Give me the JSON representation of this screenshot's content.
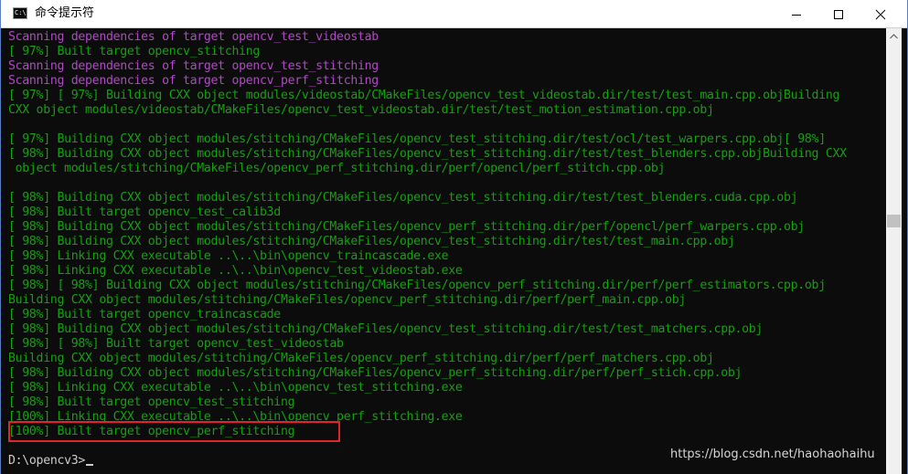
{
  "window": {
    "title": "命令提示符",
    "icon": "cmd-icon",
    "controls": [
      "minimize-icon",
      "maximize-icon",
      "close-icon"
    ]
  },
  "colors": {
    "background": "#0c0c0c",
    "magenta_text": "#b148c6",
    "green_text": "#13a10e",
    "default_text": "#cccccc",
    "highlight_box": "#e0242a"
  },
  "console": {
    "lines": [
      {
        "text": "Scanning dependencies of target opencv_test_videostab",
        "color": "magenta"
      },
      {
        "text": "[ 97%] Built target opencv_stitching",
        "color": "green"
      },
      {
        "text": "Scanning dependencies of target opencv_test_stitching",
        "color": "magenta"
      },
      {
        "text": "Scanning dependencies of target opencv_perf_stitching",
        "color": "magenta"
      },
      {
        "text": "[ 97%] [ 97%] Building CXX object modules/videostab/CMakeFiles/opencv_test_videostab.dir/test/test_main.cpp.objBuilding",
        "color": "green"
      },
      {
        "text": "CXX object modules/videostab/CMakeFiles/opencv_test_videostab.dir/test/test_motion_estimation.cpp.obj",
        "color": "green"
      },
      {
        "text": "",
        "color": "green"
      },
      {
        "text": "[ 97%] Building CXX object modules/stitching/CMakeFiles/opencv_test_stitching.dir/test/ocl/test_warpers.cpp.obj[ 98%]",
        "color": "green"
      },
      {
        "text": "[ 98%] Building CXX object modules/stitching/CMakeFiles/opencv_test_stitching.dir/test/test_blenders.cpp.objBuilding CXX",
        "color": "green"
      },
      {
        "text": " object modules/stitching/CMakeFiles/opencv_perf_stitching.dir/perf/opencl/perf_stitch.cpp.obj",
        "color": "green"
      },
      {
        "text": "",
        "color": "green"
      },
      {
        "text": "[ 98%] Building CXX object modules/stitching/CMakeFiles/opencv_test_stitching.dir/test/test_blenders.cuda.cpp.obj",
        "color": "green"
      },
      {
        "text": "[ 98%] Built target opencv_test_calib3d",
        "color": "green"
      },
      {
        "text": "[ 98%] Building CXX object modules/stitching/CMakeFiles/opencv_perf_stitching.dir/perf/opencl/perf_warpers.cpp.obj",
        "color": "green"
      },
      {
        "text": "[ 98%] Building CXX object modules/stitching/CMakeFiles/opencv_test_stitching.dir/test/test_main.cpp.obj",
        "color": "green"
      },
      {
        "text": "[ 98%] Linking CXX executable ..\\..\\bin\\opencv_traincascade.exe",
        "color": "green"
      },
      {
        "text": "[ 98%] Linking CXX executable ..\\..\\bin\\opencv_test_videostab.exe",
        "color": "green"
      },
      {
        "text": "[ 98%] [ 98%] Building CXX object modules/stitching/CMakeFiles/opencv_perf_stitching.dir/perf/perf_estimators.cpp.obj",
        "color": "green"
      },
      {
        "text": "Building CXX object modules/stitching/CMakeFiles/opencv_perf_stitching.dir/perf/perf_main.cpp.obj",
        "color": "green"
      },
      {
        "text": "[ 98%] Built target opencv_traincascade",
        "color": "green"
      },
      {
        "text": "[ 98%] Building CXX object modules/stitching/CMakeFiles/opencv_test_stitching.dir/test/test_matchers.cpp.obj",
        "color": "green"
      },
      {
        "text": "[ 98%] [ 98%] Built target opencv_test_videostab",
        "color": "green"
      },
      {
        "text": "Building CXX object modules/stitching/CMakeFiles/opencv_perf_stitching.dir/perf/perf_matchers.cpp.obj",
        "color": "green"
      },
      {
        "text": "[ 98%] Building CXX object modules/stitching/CMakeFiles/opencv_perf_stitching.dir/perf/perf_stich.cpp.obj",
        "color": "green"
      },
      {
        "text": "[ 98%] Linking CXX executable ..\\..\\bin\\opencv_test_stitching.exe",
        "color": "green"
      },
      {
        "text": "[ 98%] Built target opencv_test_stitching",
        "color": "green"
      },
      {
        "text": "[100%] Linking CXX executable ..\\..\\bin\\opencv_perf_stitching.exe",
        "color": "green"
      },
      {
        "text": "[100%] Built target opencv_perf_stitching",
        "color": "green"
      },
      {
        "text": "",
        "color": "gray"
      },
      {
        "text": "D:\\opencv3>",
        "color": "gray"
      }
    ]
  },
  "watermark": "https://blog.csdn.net/haohaohaihu"
}
